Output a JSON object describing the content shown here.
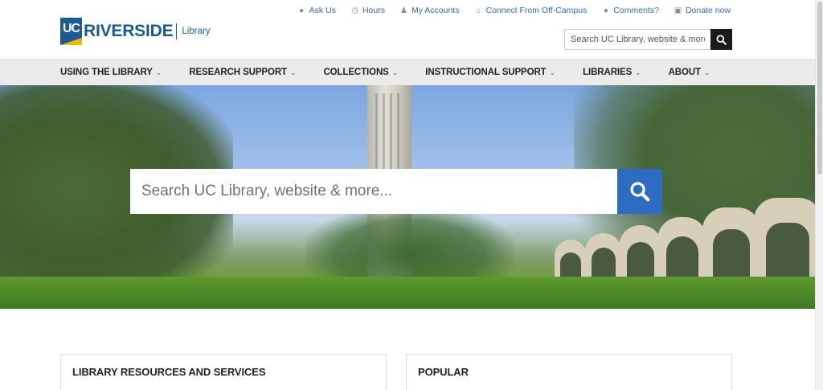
{
  "utility_links": [
    {
      "label": "Ask Us",
      "icon": "chat-bubble-icon"
    },
    {
      "label": "Hours",
      "icon": "clock-icon"
    },
    {
      "label": "My Accounts",
      "icon": "user-icon"
    },
    {
      "label": "Connect From Off-Campus",
      "icon": "home-icon"
    },
    {
      "label": "Comments?",
      "icon": "comment-icon"
    },
    {
      "label": "Donate now",
      "icon": "gift-icon"
    }
  ],
  "logo": {
    "uc": "UC",
    "name": "RIVERSIDE",
    "sub": "Library"
  },
  "header_search": {
    "placeholder": "Search UC Library, website & more..."
  },
  "nav": [
    {
      "label": "USING THE LIBRARY"
    },
    {
      "label": "RESEARCH SUPPORT"
    },
    {
      "label": "COLLECTIONS"
    },
    {
      "label": "INSTRUCTIONAL SUPPORT"
    },
    {
      "label": "LIBRARIES"
    },
    {
      "label": "ABOUT"
    }
  ],
  "hero_search": {
    "placeholder": "Search UC Library, website & more..."
  },
  "sections": [
    {
      "title": "LIBRARY RESOURCES AND SERVICES"
    },
    {
      "title": "POPULAR"
    }
  ],
  "colors": {
    "brand_blue": "#1a5b96",
    "link_blue": "#2d6cc0",
    "gold": "#f5b50a"
  }
}
